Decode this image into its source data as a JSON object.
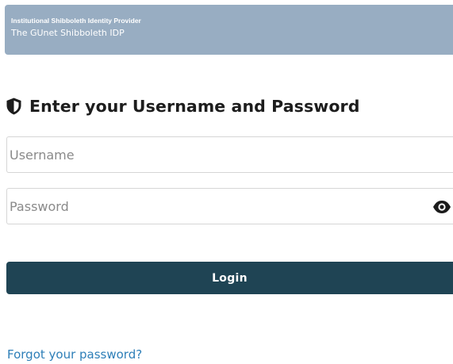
{
  "banner": {
    "title": "Institutional Shibboleth Identity Provider",
    "name": "The GUnet Shibboleth IDP",
    "color": "#98adc2"
  },
  "login": {
    "heading": "Enter your Username and Password",
    "heading_icon": "shield-icon",
    "username": {
      "placeholder": "Username",
      "value": ""
    },
    "password": {
      "placeholder": "Password",
      "value": "",
      "toggle_icon": "eye-icon"
    },
    "submit_label": "Login",
    "button_color": "#1f4454",
    "forgot_label": "Forgot your password?",
    "link_color": "#2e7fb8"
  }
}
